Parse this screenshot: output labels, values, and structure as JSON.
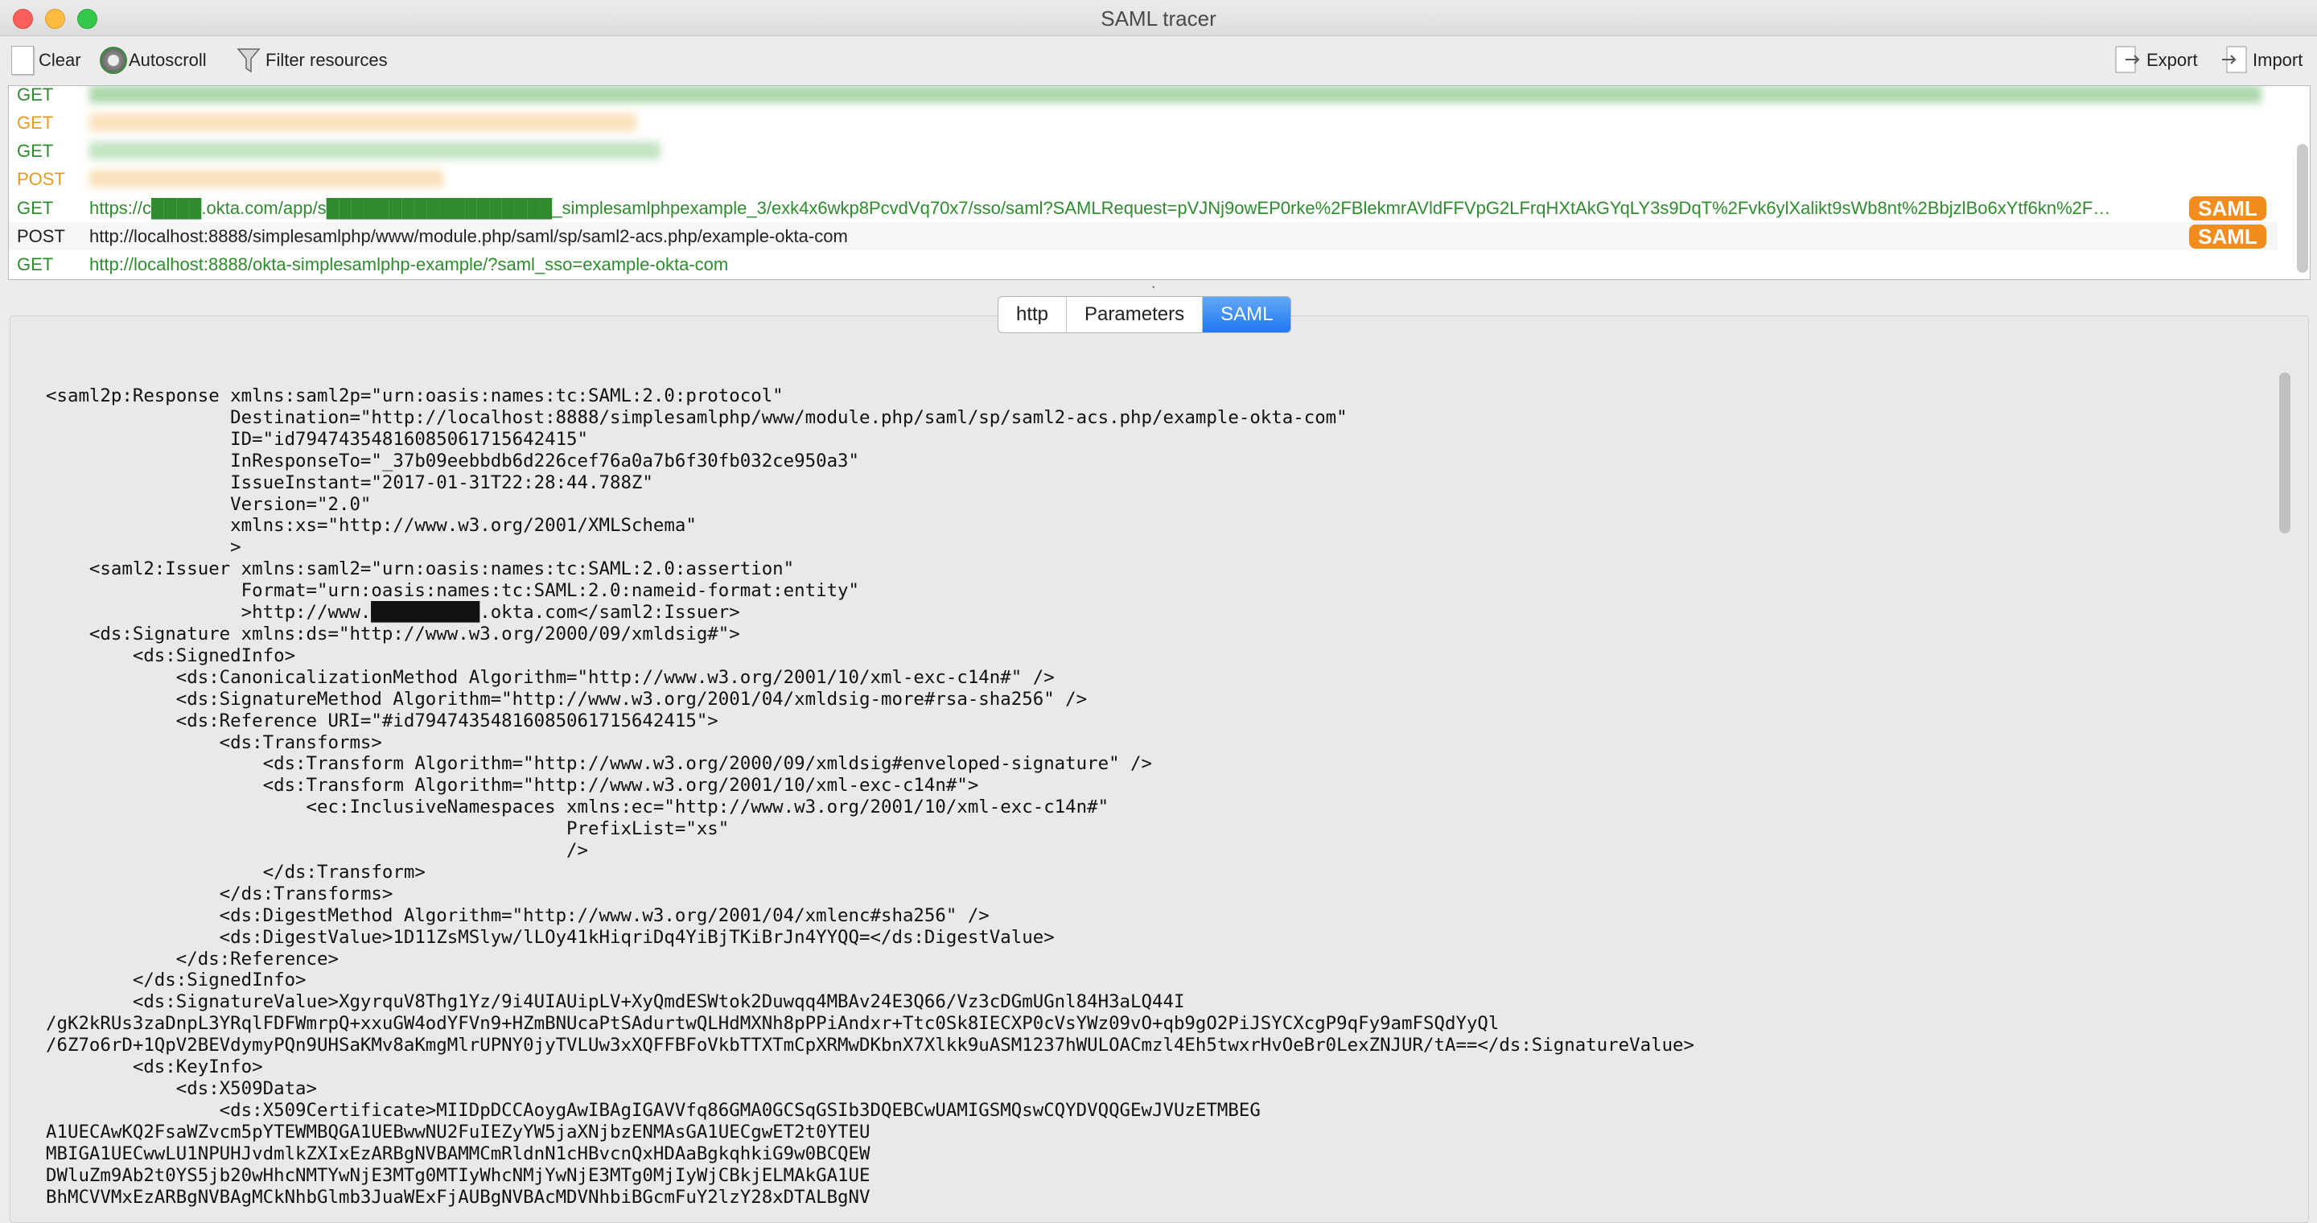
{
  "window": {
    "title": "SAML tracer"
  },
  "toolbar": {
    "clear": "Clear",
    "autoscroll": "Autoscroll",
    "filter": "Filter resources",
    "export": "Export",
    "import": "Import"
  },
  "requests": [
    {
      "method": "GET",
      "url": "",
      "color": "#2e8b2e",
      "saml": false
    },
    {
      "method": "GET",
      "url": "",
      "color": "#e79a1c",
      "saml": false
    },
    {
      "method": "GET",
      "url": "",
      "color": "#2e8b2e",
      "saml": false
    },
    {
      "method": "POST",
      "url": "",
      "color": "#e79a1c",
      "saml": false
    },
    {
      "method": "GET",
      "url": "https://c████.okta.com/app/s██████████████████_simplesamlphpexample_3/exk4x6wkp8PcvdVq70x7/sso/saml?SAMLRequest=pVJNj9owEP0rke%2FBlekmrAVldFFVpG2LFrqHXtAkGYqLY3s9DqT%2Fvk6ylXalikt9sWb8nt%2BbjzlBo6xYtf6kn%2F…",
      "color": "#2e8b2e",
      "saml": true
    },
    {
      "method": "POST",
      "url": "http://localhost:8888/simplesamlphp/www/module.php/saml/sp/saml2-acs.php/example-okta-com",
      "color": "#222222",
      "saml": true
    },
    {
      "method": "GET",
      "url": "http://localhost:8888/okta-simplesamlphp-example/?saml_sso=example-okta-com",
      "color": "#2e8b2e",
      "saml": false
    }
  ],
  "saml_badge": "SAML",
  "tabs": [
    {
      "label": "http",
      "active": false
    },
    {
      "label": "Parameters",
      "active": false
    },
    {
      "label": "SAML",
      "active": true
    }
  ],
  "xml_lines": [
    "<saml2p:Response xmlns:saml2p=\"urn:oasis:names:tc:SAML:2.0:protocol\"",
    "                 Destination=\"http://localhost:8888/simplesamlphp/www/module.php/saml/sp/saml2-acs.php/example-okta-com\"",
    "                 ID=\"id79474354816085061715642415\"",
    "                 InResponseTo=\"_37b09eebbdb6d226cef76a0a7b6f30fb032ce950a3\"",
    "                 IssueInstant=\"2017-01-31T22:28:44.788Z\"",
    "                 Version=\"2.0\"",
    "                 xmlns:xs=\"http://www.w3.org/2001/XMLSchema\"",
    "                 >",
    "    <saml2:Issuer xmlns:saml2=\"urn:oasis:names:tc:SAML:2.0:assertion\"",
    "                  Format=\"urn:oasis:names:tc:SAML:2.0:nameid-format:entity\"",
    "                  >http://www.██████████.okta.com</saml2:Issuer>",
    "    <ds:Signature xmlns:ds=\"http://www.w3.org/2000/09/xmldsig#\">",
    "        <ds:SignedInfo>",
    "            <ds:CanonicalizationMethod Algorithm=\"http://www.w3.org/2001/10/xml-exc-c14n#\" />",
    "            <ds:SignatureMethod Algorithm=\"http://www.w3.org/2001/04/xmldsig-more#rsa-sha256\" />",
    "            <ds:Reference URI=\"#id79474354816085061715642415\">",
    "                <ds:Transforms>",
    "                    <ds:Transform Algorithm=\"http://www.w3.org/2000/09/xmldsig#enveloped-signature\" />",
    "                    <ds:Transform Algorithm=\"http://www.w3.org/2001/10/xml-exc-c14n#\">",
    "                        <ec:InclusiveNamespaces xmlns:ec=\"http://www.w3.org/2001/10/xml-exc-c14n#\"",
    "                                                PrefixList=\"xs\"",
    "                                                />",
    "                    </ds:Transform>",
    "                </ds:Transforms>",
    "                <ds:DigestMethod Algorithm=\"http://www.w3.org/2001/04/xmlenc#sha256\" />",
    "                <ds:DigestValue>1D11ZsMSlyw/lLOy41kHiqriDq4YiBjTKiBrJn4YYQQ=</ds:DigestValue>",
    "            </ds:Reference>",
    "        </ds:SignedInfo>",
    "        <ds:SignatureValue>XgyrquV8Thg1Yz/9i4UIAUipLV+XyQmdESWtok2Duwqq4MBAv24E3Q66/Vz3cDGmUGnl84H3aLQ44I",
    "/gK2kRUs3zaDnpL3YRqlFDFWmrpQ+xxuGW4odYFVn9+HZmBNUcaPtSAdurtwQLHdMXNh8pPPiAndxr+Ttc0Sk8IECXP0cVsYWz09vO+qb9gO2PiJSYCXcgP9qFy9amFSQdYyQl",
    "/6Z7o6rD+1QpV2BEVdymyPQn9UHSaKMv8aKmgMlrUPNY0jyTVLUw3xXQFFBFoVkbTTXTmCpXRMwDKbnX7Xlkk9uASM1237hWULOACmzl4Eh5twxrHvOeBr0LexZNJUR/tA==</ds:SignatureValue>",
    "        <ds:KeyInfo>",
    "            <ds:X509Data>",
    "                <ds:X509Certificate>MIIDpDCCAoygAwIBAgIGAVVfq86GMA0GCSqGSIb3DQEBCwUAMIGSMQswCQYDVQQGEwJVUzETMBEG",
    "A1UECAwKQ2FsaWZvcm5pYTEWMBQGA1UEBwwNU2FuIEZyYW5jaXNjbzENMAsGA1UECgwET2t0YTEU",
    "MBIGA1UECwwLU1NPUHJvdmlkZXIxEzARBgNVBAMMCmRldnN1cHBvcnQxHDAaBgkqhkiG9w0BCQEW",
    "DWluZm9Ab2t0YS5jb20wHhcNMTYwNjE3MTg0MTIyWhcNMjYwNjE3MTg0MjIyWjCBkjELMAkGA1UE",
    "BhMCVVMxEzARBgNVBAgMCkNhbGlmb3JuaWExFjAUBgNVBAcMDVNhbiBGcmFuY2lzY28xDTALBgNV"
  ]
}
